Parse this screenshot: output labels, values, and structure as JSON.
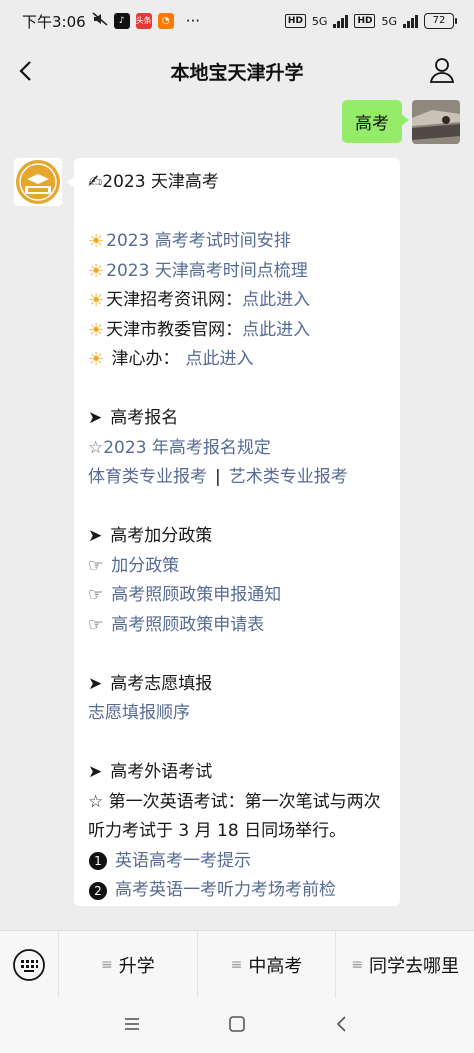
{
  "status": {
    "time": "下午3:06",
    "battery": "72",
    "net_a": "5G",
    "net_b": "5G",
    "hd": "HD",
    "app_news": "头条"
  },
  "header": {
    "title": "本地宝天津升学"
  },
  "outgoing": {
    "text": "高考"
  },
  "message": {
    "title_emoji": "✍",
    "title": "2023 天津高考",
    "links": [
      {
        "text": "2023 高考考试时间安排"
      },
      {
        "text": "2023 天津高考时间点梳理"
      }
    ],
    "resources": [
      {
        "label": "天津招考资讯网：",
        "link": "点此进入"
      },
      {
        "label": "天津市教委官网：",
        "link": "点此进入"
      },
      {
        "label": " 津心办：",
        "link": "点此进入"
      }
    ],
    "sections": {
      "signup": {
        "heading": "高考报名",
        "rule": "☆2023 年高考报名规定",
        "link1": "体育类专业报考",
        "separator": "|",
        "link2": "艺术类专业报考"
      },
      "bonus": {
        "heading": "高考加分政策",
        "items": [
          "加分政策",
          "高考照顾政策申报通知",
          "高考照顾政策申请表"
        ]
      },
      "volunteer": {
        "heading": "高考志愿填报",
        "link": "志愿填报顺序"
      },
      "foreign": {
        "heading": "高考外语考试",
        "note": "☆ 第一次英语考试：第一次笔试与两次听力考试于 3 月 18 日同场举行。",
        "items": [
          {
            "num": "1",
            "text": "英语高考一考提示"
          },
          {
            "num": "2",
            "text": "高考英语一考听力考场考前检"
          }
        ]
      }
    }
  },
  "menu": {
    "items": [
      "升学",
      "中高考",
      "同学去哪里"
    ]
  },
  "colors": {
    "background": "#ededed",
    "bubble_out": "#95ec69",
    "bubble_in": "#ffffff",
    "link": "#576b95"
  }
}
